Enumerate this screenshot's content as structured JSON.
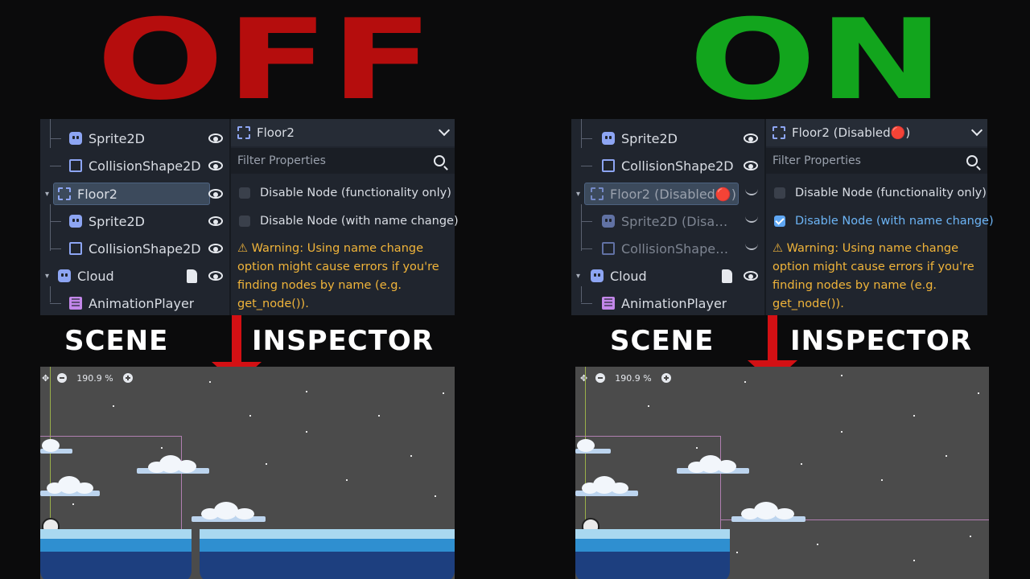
{
  "left": {
    "title": "OFF",
    "title_color": "#b50d0d",
    "scene_caption": "SCENE",
    "inspector_caption": "INSPECTOR",
    "scene_tree": [
      {
        "label": "Sprite2D",
        "icon": "sprite2d-icon",
        "visibility": "visible"
      },
      {
        "label": "CollisionShape2D",
        "icon": "collisionshape2d-icon",
        "visibility": "visible"
      },
      {
        "label": "Floor2",
        "icon": "node2d-icon",
        "visibility": "visible",
        "selected": true
      },
      {
        "label": "Sprite2D",
        "icon": "sprite2d-icon",
        "visibility": "visible"
      },
      {
        "label": "CollisionShape2D",
        "icon": "collisionshape2d-icon",
        "visibility": "visible"
      },
      {
        "label": "Cloud",
        "icon": "node2d-icon",
        "visibility": "visible",
        "script": true
      },
      {
        "label": "AnimationPlayer",
        "icon": "animationplayer-icon"
      }
    ],
    "inspector": {
      "node_name": "Floor2",
      "filter_placeholder": "Filter Properties",
      "option1": "Disable Node (functionality only)",
      "option1_checked": false,
      "option2": "Disable Node (with name change)",
      "option2_checked": false,
      "warning": "⚠ Warning: Using name change option might cause errors if you're finding nodes by name (e.g. get_node())."
    },
    "viewport": {
      "zoom": "190.9 %"
    }
  },
  "right": {
    "title": "ON",
    "title_color": "#12a51d",
    "scene_caption": "SCENE",
    "inspector_caption": "INSPECTOR",
    "scene_tree": [
      {
        "label": "Sprite2D",
        "icon": "sprite2d-icon",
        "visibility": "visible"
      },
      {
        "label": "CollisionShape2D",
        "icon": "collisionshape2d-icon",
        "visibility": "visible"
      },
      {
        "label": "Floor2 (Disabled🔴)",
        "icon": "node2d-icon",
        "visibility": "hidden",
        "selected": true
      },
      {
        "label": "Sprite2D (Disabl...",
        "icon": "sprite2d-icon",
        "visibility": "hidden"
      },
      {
        "label": "CollisionShape2...",
        "icon": "collisionshape2d-icon",
        "visibility": "hidden"
      },
      {
        "label": "Cloud",
        "icon": "node2d-icon",
        "visibility": "visible",
        "script": true
      },
      {
        "label": "AnimationPlayer",
        "icon": "animationplayer-icon"
      }
    ],
    "inspector": {
      "node_name": "Floor2 (Disabled🔴)",
      "filter_placeholder": "Filter Properties",
      "option1": "Disable Node (functionality only)",
      "option1_checked": false,
      "option2": "Disable Node (with name change)",
      "option2_checked": true,
      "warning": "⚠ Warning: Using name change option might cause errors if you're finding nodes by name (e.g. get_node())."
    },
    "viewport": {
      "zoom": "190.9 %"
    }
  }
}
